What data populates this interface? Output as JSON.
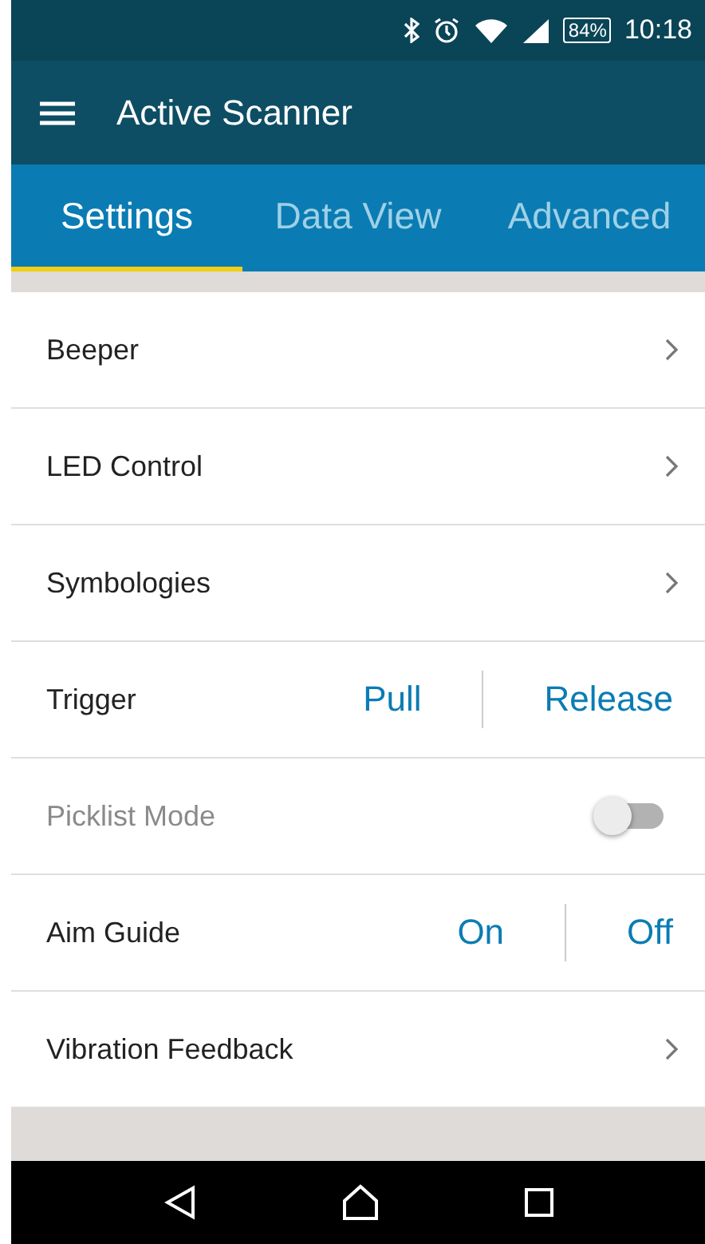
{
  "status_bar": {
    "battery": "84%",
    "time": "10:18"
  },
  "app_bar": {
    "title": "Active Scanner"
  },
  "tabs": [
    {
      "label": "Settings",
      "selected": true
    },
    {
      "label": "Data View",
      "selected": false
    },
    {
      "label": "Advanced",
      "selected": false
    }
  ],
  "settings": [
    {
      "kind": "link",
      "label": "Beeper"
    },
    {
      "kind": "link",
      "label": "LED Control"
    },
    {
      "kind": "link",
      "label": "Symbologies"
    },
    {
      "kind": "segmented",
      "label": "Trigger",
      "options": [
        "Pull",
        "Release"
      ]
    },
    {
      "kind": "toggle",
      "label": "Picklist Mode",
      "disabled": true,
      "on": false
    },
    {
      "kind": "segmented",
      "label": "Aim Guide",
      "options": [
        "On",
        "Off"
      ]
    },
    {
      "kind": "link",
      "label": "Vibration Feedback"
    }
  ]
}
